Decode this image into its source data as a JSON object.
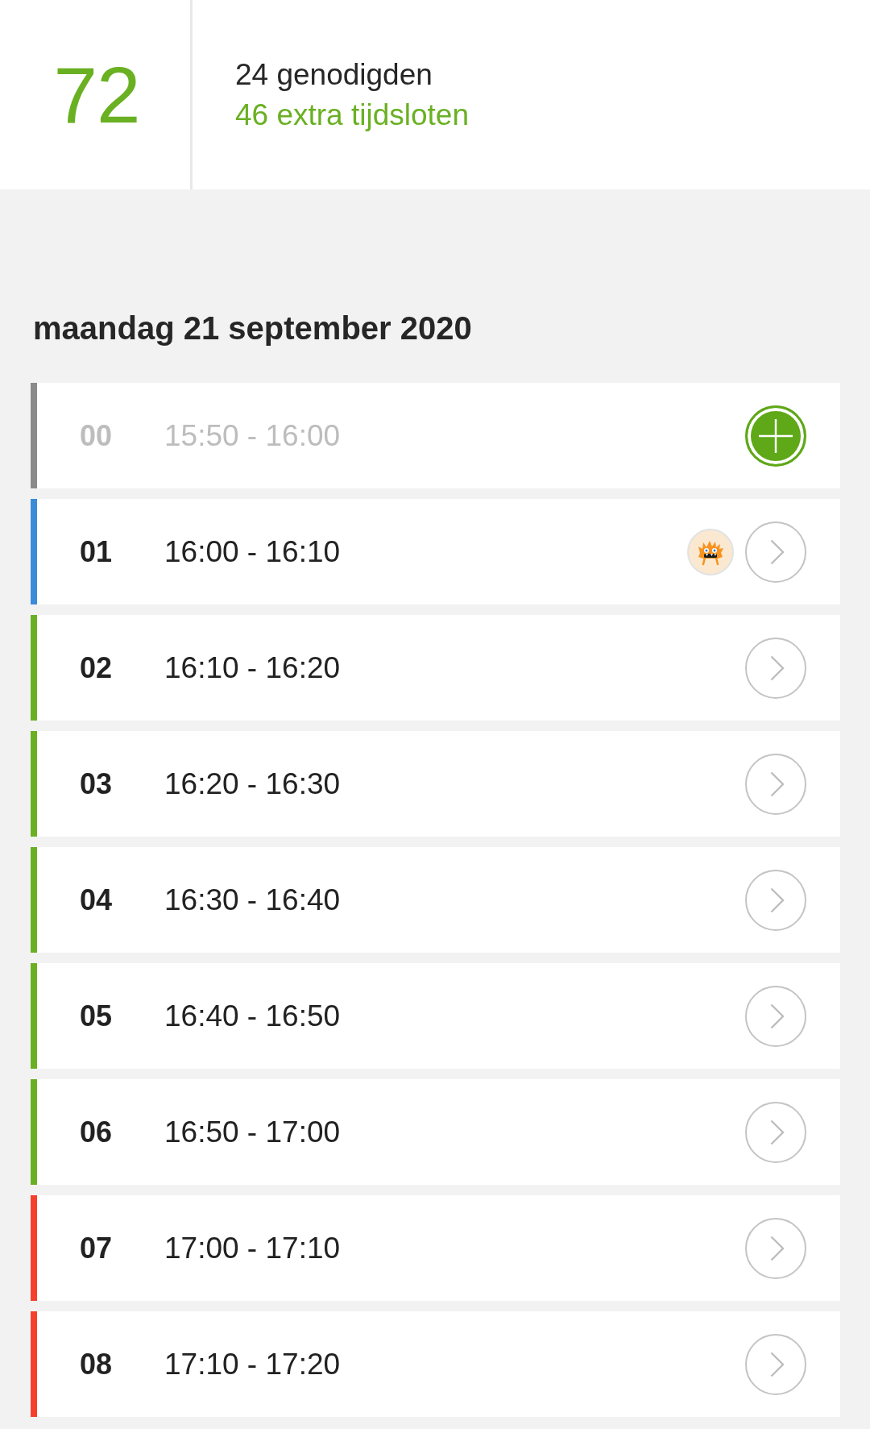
{
  "summary": {
    "total": "72",
    "invited": "24 genodigden",
    "extra": "46 extra tijdsloten"
  },
  "date": "maandag 21 september 2020",
  "slots": [
    {
      "number": "00",
      "time": "15:50 - 16:00",
      "color": "#8a8a8a",
      "disabled": true,
      "kind": "add",
      "avatar": false
    },
    {
      "number": "01",
      "time": "16:00 - 16:10",
      "color": "#3a8bd8",
      "disabled": false,
      "kind": "open",
      "avatar": true
    },
    {
      "number": "02",
      "time": "16:10 - 16:20",
      "color": "#6ab023",
      "disabled": false,
      "kind": "open",
      "avatar": false
    },
    {
      "number": "03",
      "time": "16:20 - 16:30",
      "color": "#6ab023",
      "disabled": false,
      "kind": "open",
      "avatar": false
    },
    {
      "number": "04",
      "time": "16:30 - 16:40",
      "color": "#6ab023",
      "disabled": false,
      "kind": "open",
      "avatar": false
    },
    {
      "number": "05",
      "time": "16:40 - 16:50",
      "color": "#6ab023",
      "disabled": false,
      "kind": "open",
      "avatar": false
    },
    {
      "number": "06",
      "time": "16:50 - 17:00",
      "color": "#6ab023",
      "disabled": false,
      "kind": "open",
      "avatar": false
    },
    {
      "number": "07",
      "time": "17:00 - 17:10",
      "color": "#f5402c",
      "disabled": false,
      "kind": "open",
      "avatar": false
    },
    {
      "number": "08",
      "time": "17:10 - 17:20",
      "color": "#f5402c",
      "disabled": false,
      "kind": "open",
      "avatar": false
    }
  ]
}
